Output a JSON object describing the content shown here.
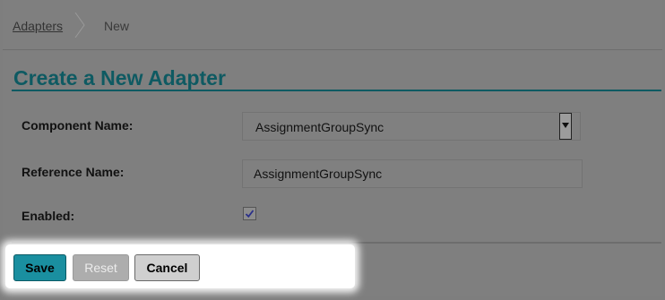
{
  "breadcrumb": {
    "items": [
      {
        "label": "Adapters"
      },
      {
        "label": "New"
      }
    ]
  },
  "page": {
    "title": "Create a New Adapter"
  },
  "form": {
    "component_name": {
      "label": "Component Name:",
      "value": "AssignmentGroupSync"
    },
    "reference_name": {
      "label": "Reference Name:",
      "value": "AssignmentGroupSync"
    },
    "enabled": {
      "label": "Enabled:",
      "checked": true
    }
  },
  "actions": {
    "save_label": "Save",
    "reset_label": "Reset",
    "cancel_label": "Cancel"
  },
  "colors": {
    "accent": "#0e5a62",
    "save_button": "#1a8fa0"
  },
  "icons": {
    "breadcrumb_separator": "chevron-right-icon",
    "select_arrow": "triangle-down-icon",
    "checkbox": "checkmark-icon"
  }
}
